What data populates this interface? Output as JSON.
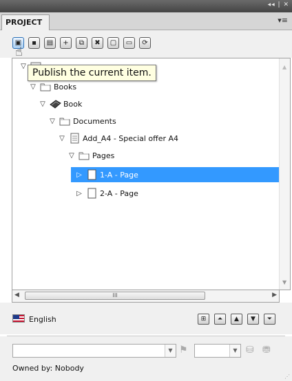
{
  "window": {
    "controls": "◂◂ | ✕"
  },
  "panel": {
    "tab_label": "PROJECT",
    "menu_icon": "▾≡"
  },
  "toolbar": {
    "buttons": [
      {
        "name": "publish-icon",
        "glyph": "▣"
      },
      {
        "name": "save-icon",
        "glyph": "▪"
      },
      {
        "name": "properties-icon",
        "glyph": "▤"
      },
      {
        "name": "add-icon",
        "glyph": "+"
      },
      {
        "name": "duplicate-icon",
        "glyph": "⧉"
      },
      {
        "name": "delete-icon",
        "glyph": "✖"
      },
      {
        "name": "page-icon",
        "glyph": "▢"
      },
      {
        "name": "frame-icon",
        "glyph": "▭"
      },
      {
        "name": "refresh-icon",
        "glyph": "⟳"
      }
    ]
  },
  "tooltip": {
    "text": "Publish the current item."
  },
  "tree": {
    "nodes": [
      {
        "label": "Books",
        "icon": "folder-icon"
      },
      {
        "label": "Book",
        "icon": "book-icon"
      },
      {
        "label": "Documents",
        "icon": "folder-icon"
      },
      {
        "label": "Add_A4 - Special offer A4",
        "icon": "document-icon"
      },
      {
        "label": "Pages",
        "icon": "folder-icon"
      },
      {
        "label": "1-A - Page",
        "icon": "page-icon"
      },
      {
        "label": "2-A - Page",
        "icon": "page-icon"
      }
    ]
  },
  "scroll": {
    "thumb_grip": "III"
  },
  "language": {
    "label": "English",
    "flag": "us-flag-icon",
    "buttons": [
      {
        "name": "language-tree-icon",
        "glyph": "⊞"
      },
      {
        "name": "move-top-icon",
        "glyph": "⏶"
      },
      {
        "name": "move-up-icon",
        "glyph": "▲"
      },
      {
        "name": "move-down-icon",
        "glyph": "▼"
      },
      {
        "name": "move-bottom-icon",
        "glyph": "⏷"
      }
    ]
  },
  "bottom": {
    "owner_text": "Owned by: Nobody",
    "combo1_value": "",
    "combo2_value": ""
  },
  "colors": {
    "selection": "#3399ff",
    "tooltip_bg": "#ffffe1"
  }
}
